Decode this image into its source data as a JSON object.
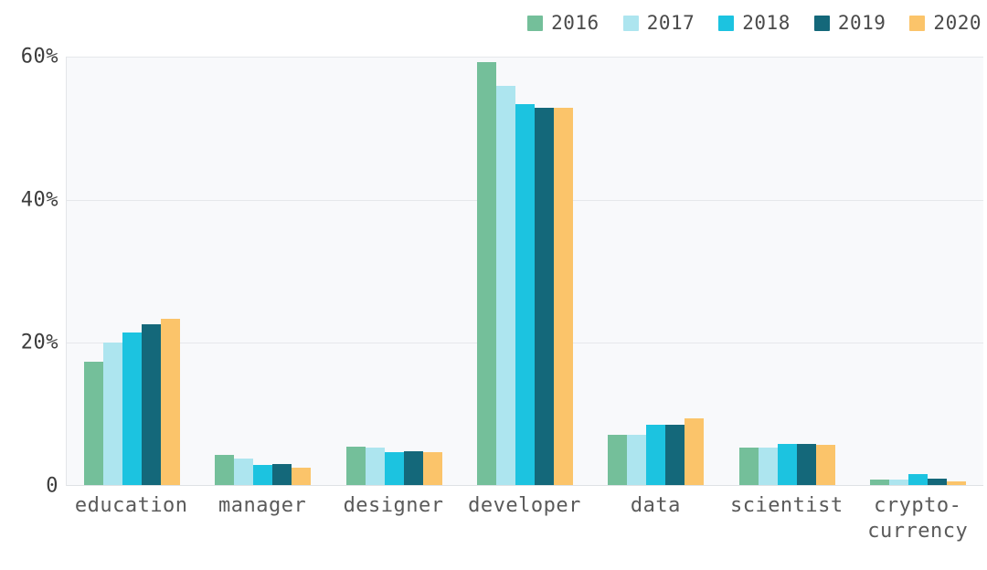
{
  "legend": {
    "position": "top-right",
    "items": [
      {
        "label": "2016",
        "color": "#74bf9a",
        "swatch_name": "legend-swatch-2016"
      },
      {
        "label": "2017",
        "color": "#ade5ef",
        "swatch_name": "legend-swatch-2017"
      },
      {
        "label": "2018",
        "color": "#1cc3e0",
        "swatch_name": "legend-swatch-2018"
      },
      {
        "label": "2019",
        "color": "#14687a",
        "swatch_name": "legend-swatch-2019"
      },
      {
        "label": "2020",
        "color": "#fbc46a",
        "swatch_name": "legend-swatch-2020"
      }
    ]
  },
  "y_axis": {
    "ticks": [
      {
        "label": "60%",
        "value": 60
      },
      {
        "label": "40%",
        "value": 40
      },
      {
        "label": "20%",
        "value": 20
      },
      {
        "label": "0",
        "value": 0
      }
    ]
  },
  "chart_data": {
    "type": "bar",
    "title": "",
    "subtitle": "",
    "xlabel": "",
    "ylabel": "",
    "ylim": [
      0,
      60
    ],
    "grid": true,
    "legend_position": "top-right",
    "categories": [
      "education",
      "manager",
      "designer",
      "developer",
      "data",
      "scientist",
      "crypto-\ncurrency"
    ],
    "category_labels_plain": [
      "education",
      "manager",
      "designer",
      "developer",
      "data",
      "scientist",
      "crypto-currency"
    ],
    "series": [
      {
        "name": "2016",
        "color": "#74bf9a",
        "values": [
          17.3,
          4.4,
          5.5,
          59.2,
          7.1,
          5.4,
          0.9
        ]
      },
      {
        "name": "2017",
        "color": "#ade5ef",
        "values": [
          20.1,
          3.8,
          5.3,
          55.9,
          7.1,
          5.4,
          0.9
        ]
      },
      {
        "name": "2018",
        "color": "#1cc3e0",
        "values": [
          21.4,
          3.0,
          4.7,
          53.3,
          8.6,
          5.9,
          1.6
        ]
      },
      {
        "name": "2019",
        "color": "#14687a",
        "values": [
          22.6,
          3.1,
          4.8,
          52.9,
          8.6,
          5.9,
          1.0
        ]
      },
      {
        "name": "2020",
        "color": "#fbc46a",
        "values": [
          23.4,
          2.6,
          4.7,
          52.9,
          9.4,
          5.8,
          0.6
        ]
      }
    ]
  }
}
